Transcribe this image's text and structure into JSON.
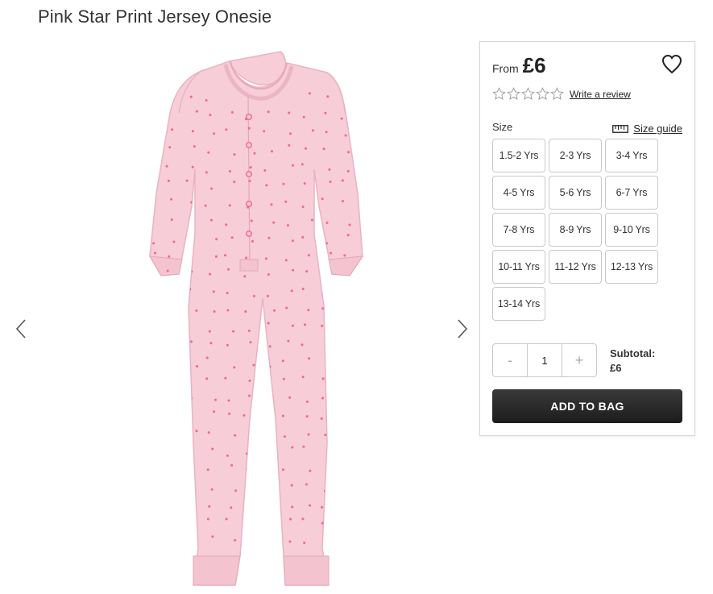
{
  "product": {
    "title": "Pink Star Print Jersey Onesie",
    "image_alt": "Pink star print jersey onesie",
    "colors": {
      "garment": "#f7cdd8",
      "dots": "#f0649a"
    }
  },
  "gallery": {
    "prev_icon": "chevron-left-icon",
    "next_icon": "chevron-right-icon"
  },
  "purchase": {
    "price_prefix": "From",
    "price": "£6",
    "wishlist_icon": "heart-icon",
    "rating": {
      "stars": 0,
      "max": 5
    },
    "review_link": "Write a review",
    "size_label": "Size",
    "size_guide_label": "Size guide",
    "size_guide_icon": "ruler-icon",
    "sizes": [
      "1.5-2 Yrs",
      "2-3 Yrs",
      "3-4 Yrs",
      "4-5 Yrs",
      "5-6 Yrs",
      "6-7 Yrs",
      "7-8 Yrs",
      "8-9 Yrs",
      "9-10 Yrs",
      "10-11 Yrs",
      "11-12 Yrs",
      "12-13 Yrs",
      "13-14 Yrs"
    ],
    "quantity": {
      "minus": "-",
      "value": "1",
      "plus": "+"
    },
    "subtotal_label": "Subtotal:",
    "subtotal_value": "£6",
    "add_to_bag": "ADD TO BAG"
  }
}
